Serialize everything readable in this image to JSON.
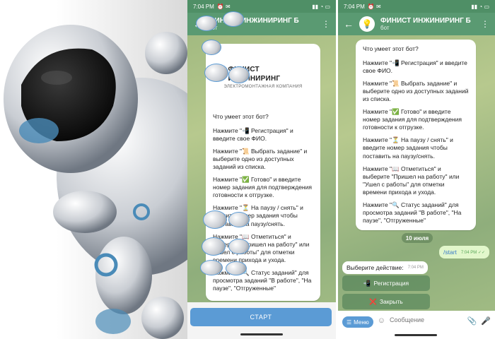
{
  "left_phone": {
    "status": {
      "time": "7:04 PM",
      "icons": "⏰ ✉",
      "right_icons": "▮▮ ◔ ▭"
    },
    "header": {
      "title": "ФИНИСТ ИНЖИНИРИНГ Б",
      "subtitle": "бот"
    },
    "logo": {
      "name": "ФИНИСТ ИНЖИНИРИНГ",
      "tagline": "ЭЛЕКТРОМОНТАЖНАЯ КОМПАНИЯ"
    },
    "intro": {
      "heading": "Что умеет этот бот?",
      "items": [
        "Нажмите \"📲 Регистрация\" и введите свое ФИО.",
        "Нажмите \"📜 Выбрать задание\" и выберите одно из доступных заданий из списка.",
        "Нажмите \"✅ Готово\" и введите номер задания для подтверждения готовности к отгрузке.",
        "Нажмите \"⏳ На паузу / снять\" и введите номер задания чтобы поставить на паузу/снять.",
        "Нажмите \"📖 Отметиться\" и выберите \"Пришел на работу\" или \"Ушел с работы\" для отметки времени прихода и ухода.",
        "Нажмите \"🔍 Статус заданий\" для просмотра заданий \"В работе\", \"На паузе\", \"Отгруженные\""
      ]
    },
    "start_button": "СТАРТ"
  },
  "right_phone": {
    "status": {
      "time": "7:04 PM",
      "icons": "⏰ ✉",
      "right_icons": "▮▮ ◔ ▭"
    },
    "header": {
      "title": "ФИНИСТ ИНЖИНИРИНГ Б",
      "subtitle": "бот"
    },
    "intro": {
      "heading": "Что умеет этот бот?",
      "items": [
        "Нажмите \"📲 Регистрация\" и введите свое ФИО.",
        "Нажмите \"📜 Выбрать задание\" и выберите одно из доступных заданий из списка.",
        "Нажмите \"✅ Готово\" и введите номер задания для подтверждения готовности к отгрузке.",
        "Нажмите \"⏳ На паузу / снять\" и введите номер задания чтобы поставить на паузу/снять.",
        "Нажмите \"📖 Отметиться\" и выберите \"Пришел на работу\" или \"Ушел с работы\" для отметки времени прихода и ухода.",
        "Нажмите \"🔍 Статус заданий\" для просмотра заданий \"В работе\", \"На паузе\", \"Отгруженные\""
      ]
    },
    "date_pill": "10 июля",
    "outgoing": {
      "text": "/start",
      "time": "7:04 PM ✓✓"
    },
    "incoming": {
      "text": "Выберите действие:",
      "time": "7:04 PM"
    },
    "keyboard": [
      {
        "icon": "📲",
        "label": "Регистрация"
      },
      {
        "icon": "❌",
        "label": "Закрыть"
      }
    ],
    "input": {
      "menu_label": "Меню",
      "placeholder": "Сообщение"
    }
  }
}
